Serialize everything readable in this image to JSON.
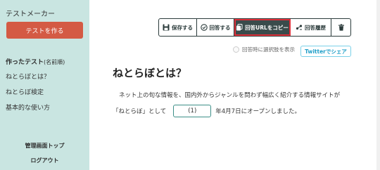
{
  "sidebar": {
    "app_title": "テストメーカー",
    "create_button": "テストを作る",
    "section_title": "作ったテスト",
    "section_sub": "(名前順)",
    "items": [
      "ねとらぼとは？",
      "ねとらぼ検定",
      "基本的な使い方"
    ],
    "admin_top": "管理画面トップ",
    "logout": "ログアウト"
  },
  "toolbar": {
    "save": "保存する",
    "answer": "回答する",
    "copy_url": "回答URLをコピー",
    "history": "回答履歴"
  },
  "options": {
    "show_choices_label": "回答時に選択肢を表示",
    "twitter_share": "Twitterでシェア"
  },
  "content": {
    "title": "ねとらぼとは？",
    "line1": "ネット上の旬な情報を、国内外からジャンルを問わず幅広く紹介する情報サイトが",
    "line2_prefix": "「ねとらぼ」として",
    "blank_label": "(1)",
    "line2_suffix": "年4月7日にオープンしました。"
  },
  "colors": {
    "sidebar_bg": "#c9e5e1",
    "create_button": "#d45a44",
    "toolbar_dark": "#3a4b4b",
    "highlight": "#e0303a",
    "twitter": "#1f9ec8"
  }
}
